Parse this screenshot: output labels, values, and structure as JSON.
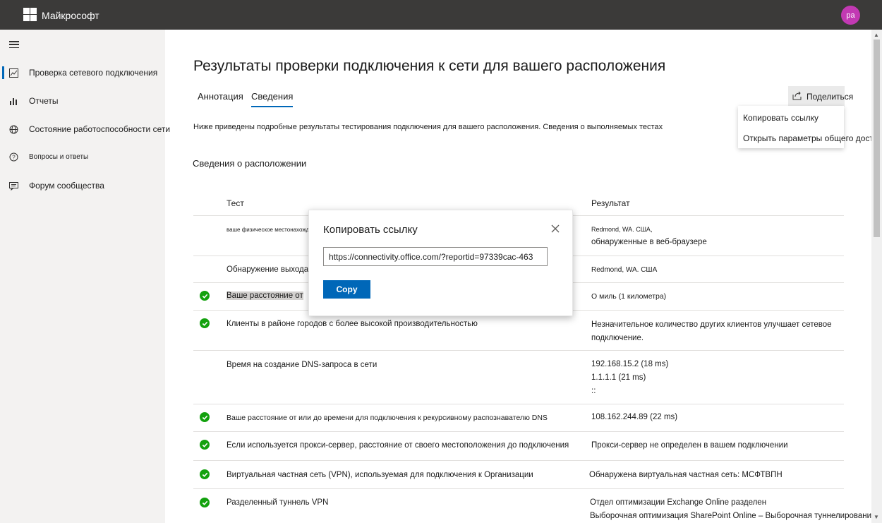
{
  "header": {
    "brand": "Майкрософт",
    "avatar_initials": "pa",
    "avatar_color": "#c239b3"
  },
  "sidebar": {
    "items": [
      {
        "label": "Проверка сетевого подключения",
        "icon": "chart-image-icon",
        "active": true
      },
      {
        "label": "Отчеты",
        "icon": "bar-chart-icon",
        "active": false
      },
      {
        "label": "Состояние работоспособности сети",
        "icon": "globe-icon",
        "active": false
      },
      {
        "label": "Вопросы и ответы",
        "icon": "question-circle-icon",
        "active": false
      },
      {
        "label": "Форум сообщества",
        "icon": "chat-icon",
        "active": false
      }
    ]
  },
  "main": {
    "title": "Результаты проверки подключения к сети для вашего расположения",
    "tabs": [
      {
        "label": "Аннотация",
        "selected": false
      },
      {
        "label": "Сведения",
        "selected": true
      }
    ],
    "share": {
      "label": "Поделиться",
      "menu": [
        "Копировать ссылку",
        "Открыть параметры общего доступа"
      ]
    },
    "intro": "Ниже приведены подробные результаты тестирования подключения для вашего расположения. Сведения о выполняемых тестах",
    "section_title": "Сведения о расположении",
    "table": {
      "headers": [
        "Тест",
        "Результат"
      ],
      "rows": [
        {
          "test": "ваше физическое местонахождение",
          "result": [
            "Redmond, WA. США,",
            "обнаруженные в веб-браузере"
          ],
          "check": false
        },
        {
          "test": "Обнаружение выхода сети",
          "result": [
            "Redmond, WA. США"
          ],
          "check": false
        },
        {
          "test": "Ваше расстояние от",
          "result": [
            "О миль (1 километра)"
          ],
          "check": true
        },
        {
          "test": "Клиенты в районе городов с более высокой производительностью",
          "result": [
            "Незначительное количество других клиентов улучшает сетевое",
            "подключение."
          ],
          "check": true
        },
        {
          "test": "Время на создание DNS-запроса в сети",
          "result": [
            "192.168.15.2 (18 ms)",
            "1.1.1.1 (21 ms)",
            "::"
          ],
          "check": false
        },
        {
          "test": "Ваше расстояние от или до времени для подключения к рекурсивному распознавателю DNS",
          "result": [
            "108.162.244.89 (22 ms)"
          ],
          "check": true
        },
        {
          "test": "Если используется прокси-сервер, расстояние от своего местоположения до подключения",
          "result": [
            "Прокси-сервер не определен в вашем подключении"
          ],
          "check": true
        },
        {
          "test": "Виртуальная частная сеть (VPN), используемая для подключения к Организации",
          "result": [
            "Обнаружена виртуальная частная сеть: МСФТВПН"
          ],
          "check": true
        },
        {
          "test": "Разделенный туннель VPN",
          "result": [
            "Отдел оптимизации Exchange Online разделен",
            "Выборочная оптимизация SharePoint Online – Выборочная туннелирование"
          ],
          "check": true
        }
      ]
    }
  },
  "modal": {
    "title": "Копировать ссылку",
    "link_value": "https://connectivity.office.com/?reportid=97339cac-463",
    "copy_label": "Copy"
  },
  "colors": {
    "topbar": "#3b3a39",
    "accent": "#0067b8",
    "success": "#13a10e"
  }
}
